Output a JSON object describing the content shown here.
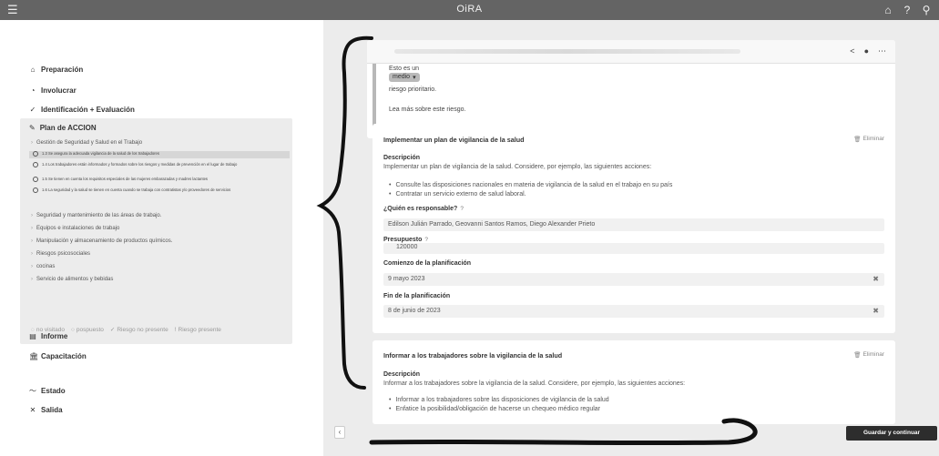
{
  "app": {
    "title": "OiRA"
  },
  "topbar": {
    "icons": [
      "home-icon",
      "help-icon",
      "user-icon"
    ]
  },
  "sidebar": {
    "nav": [
      {
        "label": "Preparación",
        "icon": "home-icon"
      },
      {
        "label": "Involucrar",
        "icon": "eye-icon"
      },
      {
        "label": "Identificación + Evaluación",
        "icon": "check-circle-icon"
      },
      {
        "label": "Plan de ACCION",
        "icon": "pencil-icon"
      },
      {
        "label": "Informe",
        "icon": "report-icon"
      },
      {
        "label": "Capacitación",
        "icon": "institution-icon"
      },
      {
        "label": "Estado",
        "icon": "chart-line-icon"
      },
      {
        "label": "Salida",
        "icon": "close-icon"
      }
    ],
    "plan_items": [
      "Gestión de Seguridad y Salud en el Trabajo",
      "Seguridad y mantenimiento de las áreas de trabajo.",
      "Equipos e instalaciones de trabajo",
      "Manipulación y almacenamiento de productos químicos.",
      "Riesgos psicosociales",
      "cocinas",
      "Servicio de alimentos y bebidas"
    ],
    "plan_subitems": [
      "1.3 Se asegura la adecuada vigilancia de la salud de los trabajadores",
      "1.4 Los trabajadores están informados y formados sobre los riesgos y medidas de prevención en el lugar de trabajo",
      "1.5 Se tienen en cuenta los requisitos especiales de las mujeres embarazadas y madres lactantes",
      "1.6 La seguridad y la salud se tienen en cuenta cuando se trabaja con contratistas y/o proveedores de servicios"
    ],
    "legend": [
      "no visitado",
      "pospuesto",
      "Riesgo no presente",
      "Riesgo presente"
    ]
  },
  "risk": {
    "line1": "Esto es un",
    "level": "medio",
    "line2": "riesgo prioritario.",
    "more": "Lea más sobre este riesgo."
  },
  "measures": [
    {
      "title": "Implementar un plan de vigilancia de la salud",
      "delete_label": "Eliminar",
      "desc_label": "Descripción",
      "desc": "Implementar un plan de vigilancia de la salud. Considere, por ejemplo, las siguientes acciones:",
      "bullets": [
        "Consulte las disposiciones nacionales en materia de vigilancia de la salud en el trabajo en su país",
        "Contratar un servicio externo de salud laboral."
      ],
      "responsible_label": "¿Quién es responsable?",
      "responsible": "Edilson Julián Parrado, Geovanni Santos Ramos, Diego Alexander Prieto",
      "budget_label": "Presupuesto",
      "budget": "120000",
      "start_label": "Comienzo de la planificación",
      "start": "9 mayo 2023",
      "end_label": "Fin de la planificación",
      "end": "8 de junio de 2023"
    },
    {
      "title": "Informar a los trabajadores sobre la vigilancia de la salud",
      "delete_label": "Eliminar",
      "desc_label": "Descripción",
      "desc": "Informar a los trabajadores sobre la vigilancia de la salud. Considere, por ejemplo, las siguientes acciones:",
      "bullets": [
        "Informar a los trabajadores sobre las disposiciones de vigilancia de la salud",
        "Enfatice la posibilidad/obligación de hacerse un chequeo médico regular"
      ]
    }
  ],
  "footer": {
    "save": "Guardar y continuar",
    "back": "‹"
  },
  "colors": {
    "topbar": "#646464",
    "save_button": "#2d2d2d",
    "active_item": "#d6d6d6"
  }
}
